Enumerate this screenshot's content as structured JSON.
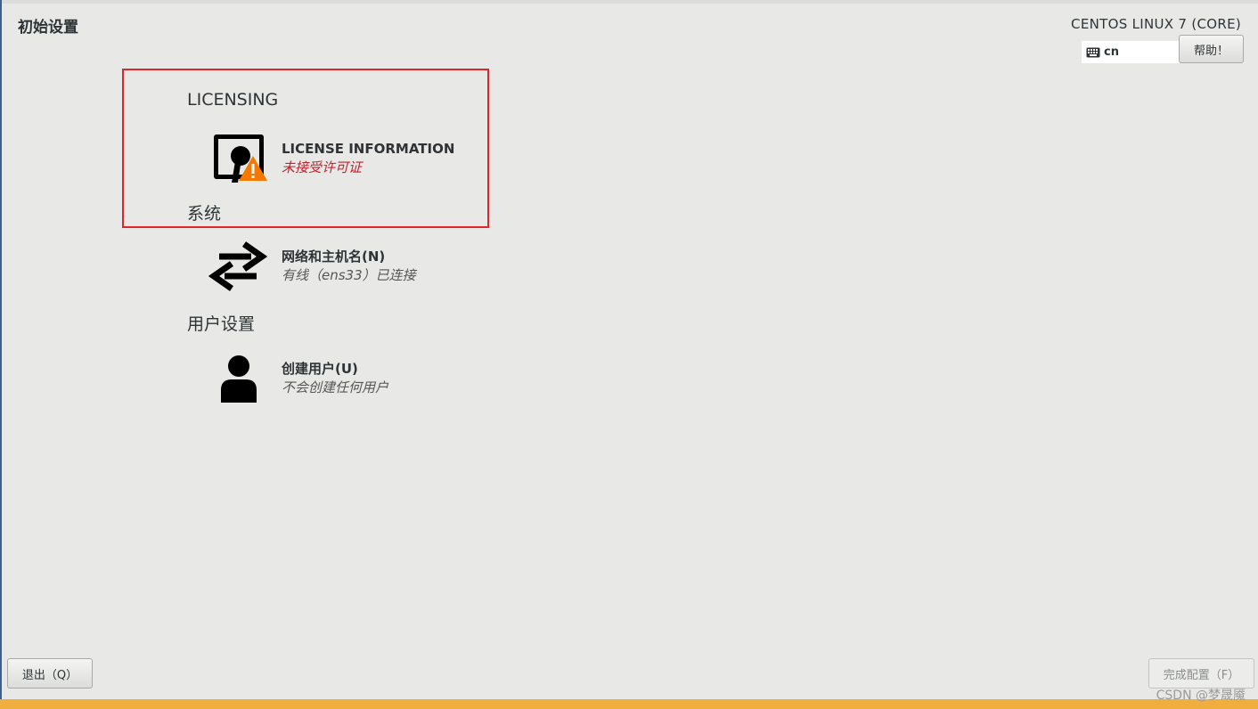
{
  "header": {
    "app_title": "初始设置",
    "product_name": "CENTOS LINUX 7 (CORE)",
    "keyboard_layout": "cn",
    "help_label": "帮助！"
  },
  "sections": [
    {
      "title": "LICENSING",
      "spokes": [
        {
          "title": "LICENSE INFORMATION",
          "status": "未接受许可证",
          "icon": "license-warning-icon"
        }
      ]
    },
    {
      "title": "系统",
      "spokes": [
        {
          "title": "网络和主机名(N)",
          "status": "有线（ens33）已连接",
          "icon": "network-arrows-icon"
        }
      ]
    },
    {
      "title": "用户设置",
      "spokes": [
        {
          "title": "创建用户(U)",
          "status": "不会创建任何用户",
          "icon": "user-icon"
        }
      ]
    }
  ],
  "footer": {
    "quit_label": "退出（Q）",
    "finish_label": "完成配置（F）",
    "watermark": "CSDN @梦晟魇"
  },
  "colors": {
    "background": "#e8e8e7",
    "highlight_border": "#e0262b",
    "warning_status": "#c4212a",
    "warning_bar": "#f0ae3f",
    "warning_triangle": "#f57900"
  }
}
